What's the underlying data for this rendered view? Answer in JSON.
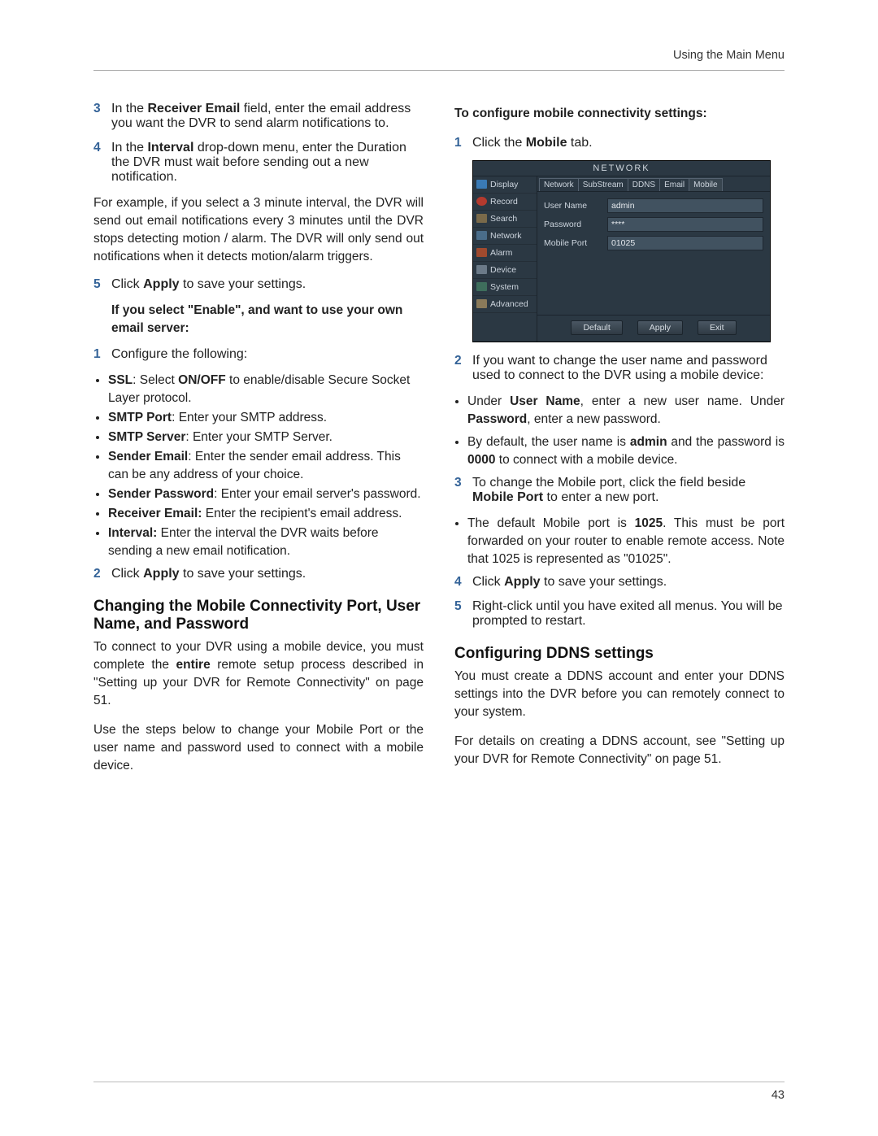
{
  "header": {
    "running": "Using the Main Menu"
  },
  "footer": {
    "page": "43"
  },
  "left": {
    "step3": {
      "num": "3",
      "prefix": "In the ",
      "bold1": "Receiver Email",
      "after1": " field, enter the email address you want the DVR to send alarm notifications to."
    },
    "step4": {
      "num": "4",
      "prefix": "In the ",
      "bold1": "Interval",
      "after1": " drop-down menu, enter the Duration the DVR must wait before sending out a new notification."
    },
    "step4b": "For example, if you select a 3 minute interval, the DVR will send out email notifications every 3 minutes until the DVR stops detecting motion / alarm. The DVR will only send out notifications when it detects motion/alarm triggers.",
    "step5": {
      "num": "5",
      "t1": "Click ",
      "b1": "Apply",
      "t2": " to save your settings."
    },
    "own_server_head": "If you select \"Enable\", and want to use your own email server:",
    "own1": {
      "num": "1",
      "t": "Configure the following:"
    },
    "bul": {
      "ssl": {
        "b1": "SSL",
        "t1": ": Select ",
        "b2": "ON/OFF",
        "t2": " to enable/disable Secure Socket Layer protocol."
      },
      "smtp_port": {
        "b1": "SMTP Port",
        "t1": ": Enter your SMTP address."
      },
      "smtp_srv": {
        "b1": "SMTP Server",
        "t1": ": Enter your SMTP Server."
      },
      "sender_e": {
        "b1": "Sender Email",
        "t1": ": Enter the sender email address. This can be any address of your choice."
      },
      "sender_p": {
        "b1": "Sender Password",
        "t1": ": Enter your email server's password."
      },
      "recv_e": {
        "b1": "Receiver Email:",
        "t1": " Enter the recipient's email address."
      },
      "interval": {
        "b1": "Interval:",
        "t1": " Enter the interval the DVR waits before sending a new email notification."
      }
    },
    "own2": {
      "num": "2",
      "t1": "Click ",
      "b1": "Apply",
      "t2": " to save your settings."
    },
    "h_mobile": "Changing the Mobile Connectivity Port, User Name, and Password",
    "p_mob1a": "To connect to your DVR using a mobile device, you must complete the ",
    "p_mob1b": "entire",
    "p_mob1c": " remote setup process described in \"Setting up your DVR for Remote Connectivity\" on page 51.",
    "p_mob2": "Use the steps below to change your Mobile Port or the user name and password used to connect with a mobile device."
  },
  "right": {
    "head1": "To configure mobile connectivity settings:",
    "r1": {
      "num": "1",
      "t1": "Click the ",
      "b1": "Mobile",
      "t2": " tab."
    },
    "dvr": {
      "title": "NETWORK",
      "sidebar": [
        "Display",
        "Record",
        "Search",
        "Network",
        "Alarm",
        "Device",
        "System",
        "Advanced"
      ],
      "tabs": [
        "Network",
        "SubStream",
        "DDNS",
        "Email",
        "Mobile"
      ],
      "active_tab_index": 4,
      "fields": {
        "user_label": "User Name",
        "user_val": "admin",
        "pw_label": "Password",
        "pw_val": "****",
        "port_label": "Mobile Port",
        "port_val": "01025"
      },
      "buttons": [
        "Default",
        "Apply",
        "Exit"
      ]
    },
    "r2": {
      "num": "2",
      "t": "If you want to change the user name and password used to connect to the DVR using a mobile device:"
    },
    "r2b": {
      "a": {
        "t1": "Under ",
        "b1": "User Name",
        "t2": ", enter a new user name. Under ",
        "b2": "Password",
        "t3": ", enter a new password."
      },
      "b": {
        "t1": "By default, the user name is ",
        "b1": "admin",
        "t2": " and the password is ",
        "b2": "0000",
        "t3": " to connect with a mobile device."
      }
    },
    "r3": {
      "num": "3",
      "t1": "To change the Mobile port, click the field beside ",
      "b1": "Mobile Port",
      "t2": " to enter a new port."
    },
    "r3b": {
      "t1": "The default Mobile port is ",
      "b1": "1025",
      "t2": ". This must be port forwarded on your router to enable remote access. Note that 1025 is represented as \"01025\"."
    },
    "r4": {
      "num": "4",
      "t1": "Click ",
      "b1": "Apply",
      "t2": " to save your settings."
    },
    "r5": {
      "num": "5",
      "t": "Right-click until you have exited all menus. You will be prompted to restart."
    },
    "h_ddns": "Configuring DDNS settings",
    "p_ddns1": "You must create a DDNS account and enter your DDNS settings into the DVR before you can remotely connect to your system.",
    "p_ddns2": "For details on creating a DDNS account, see \"Setting up your DVR for Remote Connectivity\" on page 51."
  }
}
